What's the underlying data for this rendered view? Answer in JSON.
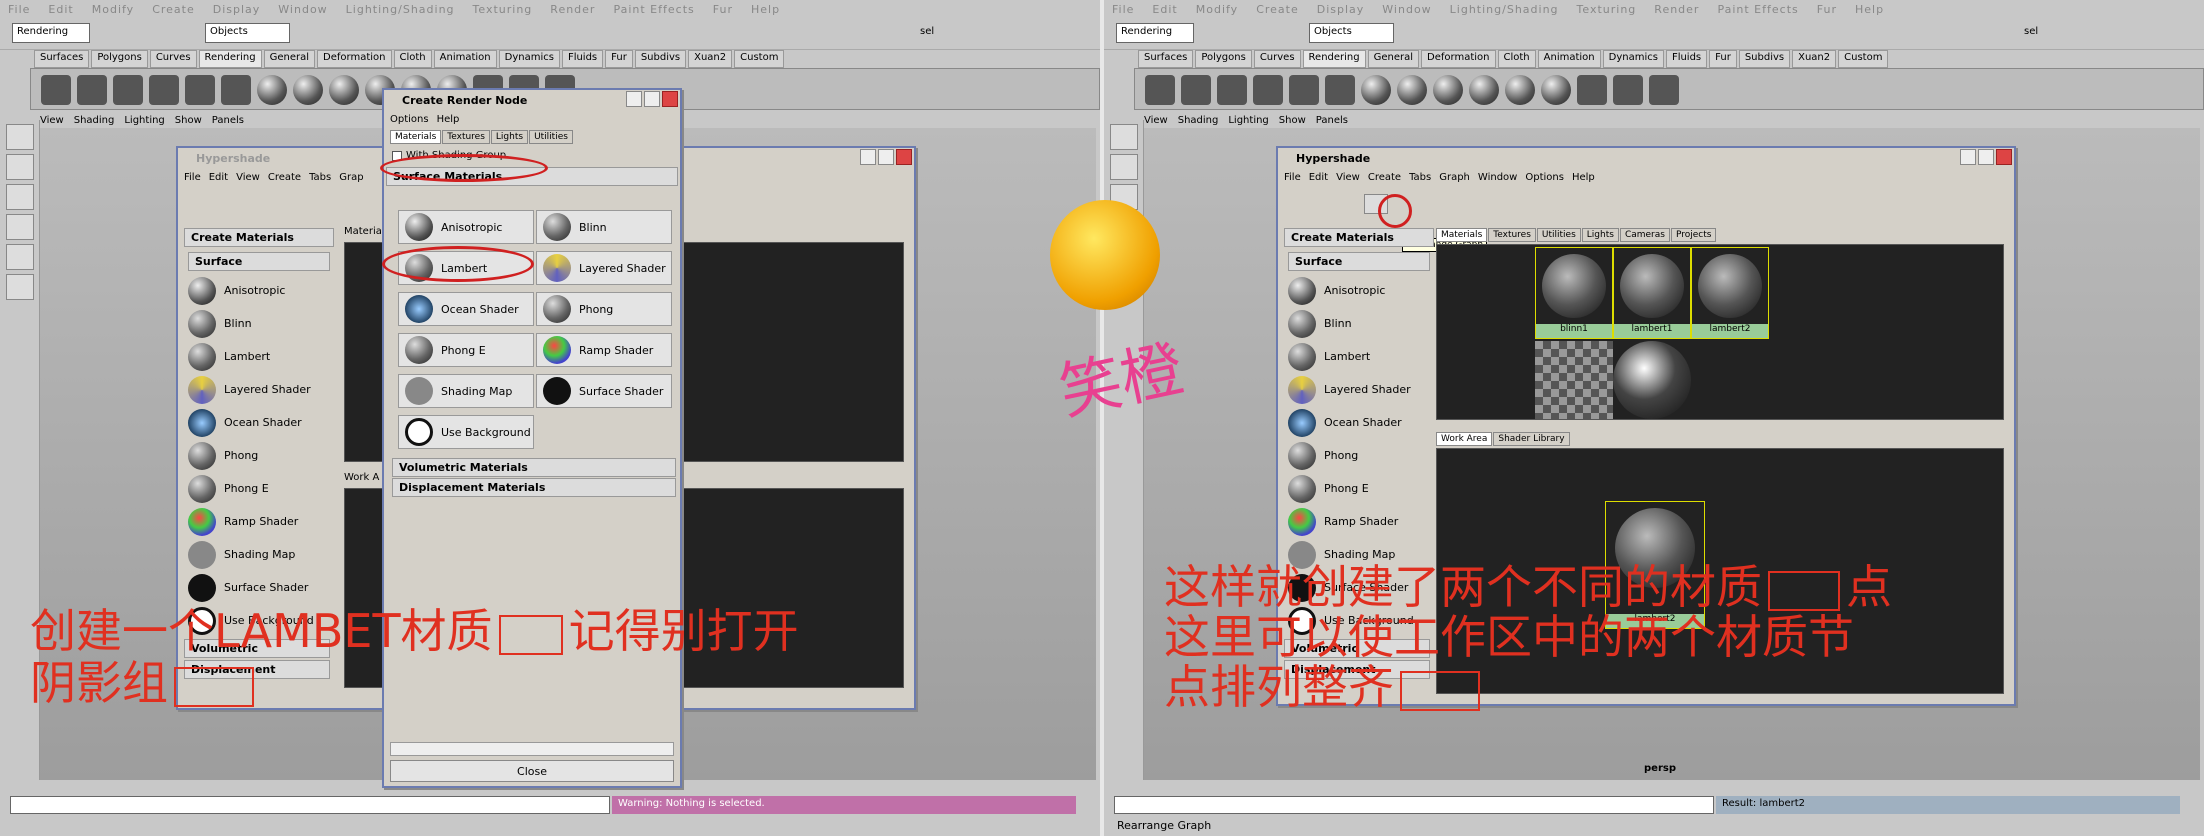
{
  "left": {
    "menubar": [
      "File",
      "Edit",
      "Modify",
      "Create",
      "Display",
      "Window",
      "Lighting/Shading",
      "Texturing",
      "Render",
      "Paint Effects",
      "Fur",
      "Help"
    ],
    "mode": "Rendering",
    "objects_field": "Objects",
    "sel_label": "sel",
    "shelf_tabs": [
      "Surfaces",
      "Polygons",
      "Curves",
      "Rendering",
      "General",
      "Deformation",
      "Cloth",
      "Animation",
      "Dynamics",
      "Fluids",
      "Fur",
      "Subdivs",
      "Xuan2",
      "Custom"
    ],
    "viewport_menu": [
      "View",
      "Shading",
      "Lighting",
      "Show",
      "Panels"
    ],
    "hypershade_title": "Hypershade",
    "hypershade_menu": [
      "File",
      "Edit",
      "View",
      "Create",
      "Tabs",
      "Grap"
    ],
    "create_materials_label": "Create Materials",
    "surface_label": "Surface",
    "materials_tab": "Materia",
    "work_area_tab": "Work A",
    "materials": [
      "Anisotropic",
      "Blinn",
      "Lambert",
      "Layered Shader",
      "Ocean Shader",
      "Phong",
      "Phong E",
      "Ramp Shader",
      "Shading Map",
      "Surface Shader",
      "Use Background"
    ],
    "volumetric": "Volumetric",
    "displacement": "Displacement",
    "warning": "Warning: Nothing is selected.",
    "annotation": [
      "创建一个LAMBET材质",
      "记得别打开",
      "阴影组"
    ]
  },
  "crn": {
    "title": "Create Render Node",
    "menu": [
      "Options",
      "Help"
    ],
    "tabs": [
      "Materials",
      "Textures",
      "Lights",
      "Utilities"
    ],
    "with_shading_group": "With Shading Group",
    "surface_materials": "Surface Materials",
    "buttons": [
      "Anisotropic",
      "Blinn",
      "Lambert",
      "Layered Shader",
      "Ocean Shader",
      "Phong",
      "Phong E",
      "Ramp Shader",
      "Shading Map",
      "Surface Shader",
      "Use Background"
    ],
    "volumetric_materials": "Volumetric Materials",
    "displacement_materials": "Displacement Materials",
    "close": "Close"
  },
  "right": {
    "hypershade_title": "Hypershade",
    "hypershade_menu": [
      "File",
      "Edit",
      "View",
      "Create",
      "Tabs",
      "Graph",
      "Window",
      "Options",
      "Help"
    ],
    "tooltip": "Rearrange Graph",
    "top_tabs": [
      "Materials",
      "Textures",
      "Utilities",
      "Lights",
      "Cameras",
      "Projects"
    ],
    "bottom_tabs": [
      "Work Area",
      "Shader Library"
    ],
    "node_labels": [
      "blinn1",
      "lambert1",
      "lambert2"
    ],
    "work_node": "lambert2",
    "persp": "persp",
    "result": "Result: lambert2",
    "helpline": "Rearrange Graph",
    "annotation": [
      "这样就创建了两个不同的材质",
      "点",
      "这里可以使工作区中的两个材质节",
      "点排列整齐"
    ]
  },
  "logo_text": "笑橙"
}
